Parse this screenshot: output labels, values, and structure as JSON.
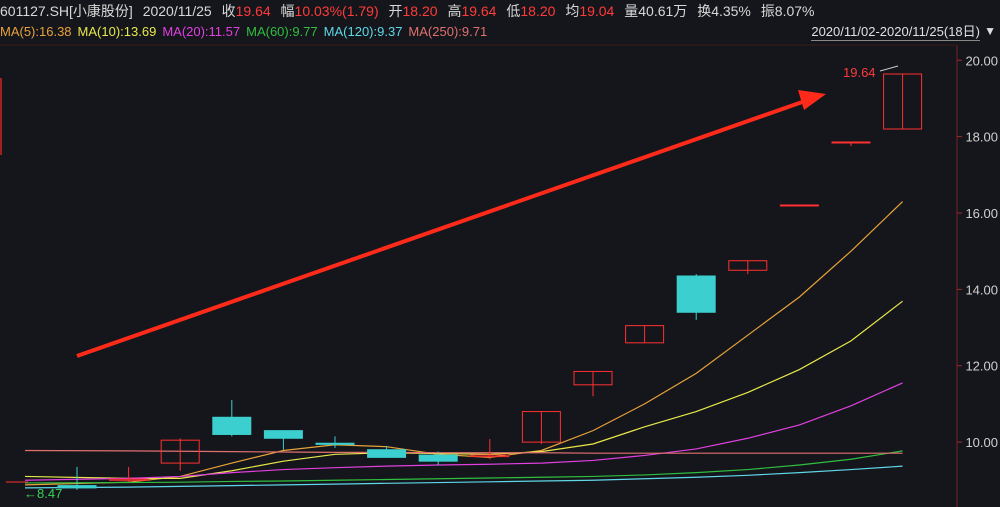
{
  "header": {
    "symbol": "601127.SH[小康股份]",
    "date": "2020/11/25",
    "close_label": "收",
    "close": "19.64",
    "change_label": "幅",
    "change": "10.03%(1.79)",
    "open_label": "开",
    "open": "18.20",
    "high_label": "高",
    "high": "19.64",
    "low_label": "低",
    "low": "18.20",
    "avg_label": "均",
    "avg": "19.04",
    "volume_label": "量",
    "volume": "40.61万",
    "turnover_label": "换",
    "turnover": "4.35%",
    "amplitude_label": "振",
    "amplitude": "8.07%"
  },
  "ma_legend": [
    {
      "text": "MA(5):16.38",
      "color": "#e8a23a"
    },
    {
      "text": "MA(10):13.69",
      "color": "#e8e84a"
    },
    {
      "text": "MA(20):11.57",
      "color": "#e040e0"
    },
    {
      "text": "MA(60):9.77",
      "color": "#2fbf3f"
    },
    {
      "text": "MA(120):9.37",
      "color": "#5fd7e8"
    },
    {
      "text": "MA(250):9.71",
      "color": "#e07070"
    }
  ],
  "date_range": "2020/11/02-2020/11/25(18日)",
  "annotations": {
    "high_marker": "19.64",
    "low_marker": "←8.47"
  },
  "chart_data": {
    "type": "candlestick",
    "ylim": [
      8.3,
      20.4
    ],
    "yticks": [
      {
        "value": 10,
        "label": "10.00"
      },
      {
        "value": 12,
        "label": "12.00"
      },
      {
        "value": 14,
        "label": "14.00"
      },
      {
        "value": 16,
        "label": "16.00"
      },
      {
        "value": 18,
        "label": "18.00"
      },
      {
        "value": 20,
        "label": "20.00"
      }
    ],
    "up_color": "#ff3030",
    "down_color": "#3ccfcf",
    "candles": [
      {
        "o": 8.86,
        "c": 8.8,
        "h": 9.35,
        "l": 8.75
      },
      {
        "o": 9.0,
        "c": 9.03,
        "h": 9.35,
        "l": 8.95
      },
      {
        "o": 9.45,
        "c": 10.05,
        "h": 10.1,
        "l": 9.25
      },
      {
        "o": 10.65,
        "c": 10.2,
        "h": 11.1,
        "l": 10.15
      },
      {
        "o": 10.3,
        "c": 10.1,
        "h": 10.3,
        "l": 9.8
      },
      {
        "o": 9.97,
        "c": 9.94,
        "h": 10.15,
        "l": 9.85
      },
      {
        "o": 9.8,
        "c": 9.6,
        "h": 9.9,
        "l": 9.6
      },
      {
        "o": 9.66,
        "c": 9.5,
        "h": 9.75,
        "l": 9.4
      },
      {
        "o": 9.62,
        "c": 9.66,
        "h": 10.08,
        "l": 9.55
      },
      {
        "o": 10.0,
        "c": 10.8,
        "h": 10.8,
        "l": 9.95
      },
      {
        "o": 11.5,
        "c": 11.85,
        "h": 11.85,
        "l": 11.2
      },
      {
        "o": 12.6,
        "c": 13.05,
        "h": 13.05,
        "l": 12.6
      },
      {
        "o": 14.35,
        "c": 13.4,
        "h": 14.4,
        "l": 13.2
      },
      {
        "o": 14.5,
        "c": 14.75,
        "h": 14.75,
        "l": 14.4
      },
      {
        "o": 16.2,
        "c": 16.21,
        "h": 16.21,
        "l": 16.2
      },
      {
        "o": 17.85,
        "c": 17.86,
        "h": 17.86,
        "l": 17.75
      },
      {
        "o": 18.2,
        "c": 19.64,
        "h": 19.64,
        "l": 18.2
      }
    ],
    "ma_lines": [
      {
        "name": "MA(5)",
        "color": "#e8a23a",
        "values": [
          8.88,
          8.95,
          9.1,
          9.45,
          9.78,
          9.93,
          9.88,
          9.68,
          9.6,
          9.78,
          10.3,
          11.0,
          11.8,
          12.8,
          13.8,
          15.0,
          16.3
        ]
      },
      {
        "name": "MA(10)",
        "color": "#e8e84a",
        "values": [
          9.1,
          9.05,
          9.05,
          9.25,
          9.5,
          9.68,
          9.72,
          9.7,
          9.68,
          9.75,
          9.95,
          10.4,
          10.8,
          11.3,
          11.9,
          12.65,
          13.69
        ]
      },
      {
        "name": "MA(20)",
        "color": "#e040e0",
        "values": [
          9.0,
          9.05,
          9.1,
          9.2,
          9.28,
          9.33,
          9.37,
          9.4,
          9.42,
          9.45,
          9.52,
          9.65,
          9.82,
          10.1,
          10.45,
          10.95,
          11.55
        ]
      },
      {
        "name": "MA(60)",
        "color": "#2fbf3f",
        "values": [
          8.93,
          8.94,
          8.95,
          8.97,
          8.98,
          9.0,
          9.02,
          9.04,
          9.06,
          9.08,
          9.1,
          9.14,
          9.2,
          9.28,
          9.4,
          9.55,
          9.77
        ]
      },
      {
        "name": "MA(120)",
        "color": "#5fd7e8",
        "values": [
          8.8,
          8.82,
          8.84,
          8.86,
          8.88,
          8.9,
          8.92,
          8.94,
          8.96,
          8.98,
          9.0,
          9.04,
          9.08,
          9.13,
          9.2,
          9.28,
          9.37
        ]
      },
      {
        "name": "MA(250)",
        "color": "#e07070",
        "values": [
          9.78,
          9.77,
          9.76,
          9.75,
          9.74,
          9.73,
          9.73,
          9.72,
          9.72,
          9.72,
          9.71,
          9.71,
          9.71,
          9.71,
          9.71,
          9.71,
          9.71
        ]
      }
    ]
  }
}
